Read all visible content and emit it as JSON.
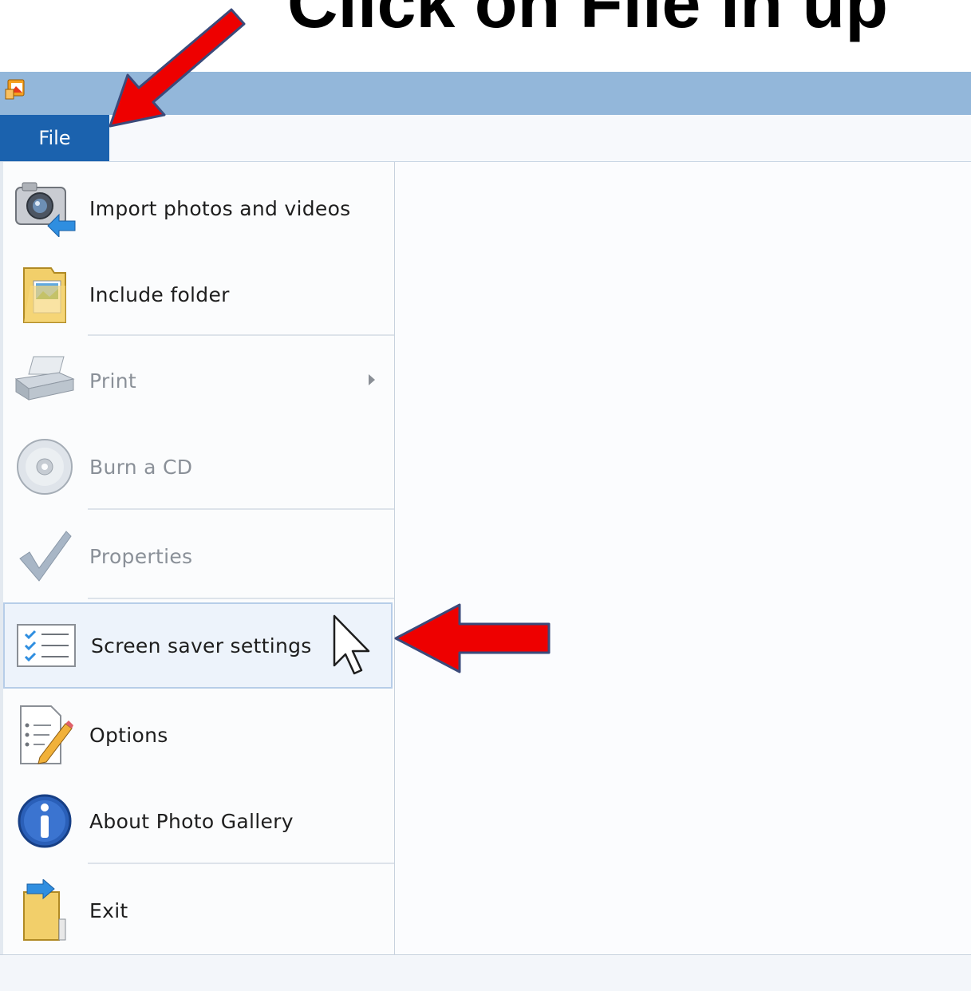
{
  "annotation": {
    "headline": "Click on File in up"
  },
  "app": {
    "icon": "photo-gallery-icon"
  },
  "menubar": {
    "file_label": "File"
  },
  "file_menu": {
    "items": [
      {
        "label": "Import photos and videos",
        "icon": "camera-import-icon",
        "enabled": true
      },
      {
        "label": "Include folder",
        "icon": "folder-photos-icon",
        "enabled": true
      },
      {
        "label": "Print",
        "icon": "printer-icon",
        "enabled": false,
        "has_submenu": true
      },
      {
        "label": "Burn a CD",
        "icon": "cd-icon",
        "enabled": false
      },
      {
        "label": "Properties",
        "icon": "checkmark-icon",
        "enabled": false
      },
      {
        "label": "Screen saver settings",
        "icon": "checklist-icon",
        "enabled": true,
        "highlighted": true
      },
      {
        "label": "Options",
        "icon": "options-pencil-icon",
        "enabled": true
      },
      {
        "label": "About Photo Gallery",
        "icon": "info-icon",
        "enabled": true
      },
      {
        "label": "Exit",
        "icon": "exit-door-icon",
        "enabled": true
      }
    ]
  },
  "colors": {
    "titlebar": "#93b7da",
    "file_tab": "#1b62ae",
    "annotation_arrow": "#ee0000"
  }
}
